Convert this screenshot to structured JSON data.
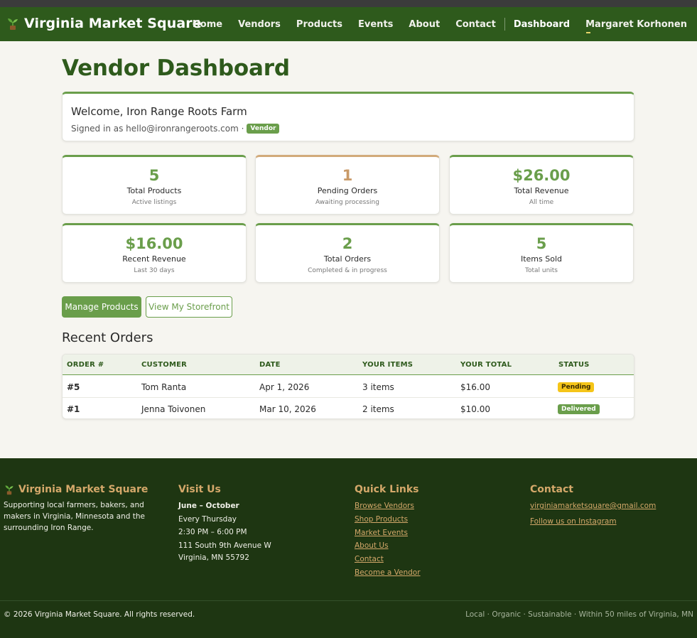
{
  "nav": {
    "brand": "Virginia Market Square",
    "links": [
      "Home",
      "Vendors",
      "Products",
      "Events",
      "About",
      "Contact"
    ],
    "dashboard": "Dashboard",
    "user": "Margaret Korhonen"
  },
  "page": {
    "title": "Vendor Dashboard",
    "welcome_title": "Welcome, Iron Range Roots Farm",
    "signed_in_text": "Signed in as hello@ironrangeroots.com ·",
    "role_badge": "Vendor"
  },
  "stats": [
    {
      "value": "5",
      "label": "Total Products",
      "sub": "Active listings"
    },
    {
      "value": "1",
      "label": "Pending Orders",
      "sub": "Awaiting processing"
    },
    {
      "value": "$26.00",
      "label": "Total Revenue",
      "sub": "All time"
    },
    {
      "value": "$16.00",
      "label": "Recent Revenue",
      "sub": "Last 30 days"
    },
    {
      "value": "2",
      "label": "Total Orders",
      "sub": "Completed & in progress"
    },
    {
      "value": "5",
      "label": "Items Sold",
      "sub": "Total units"
    }
  ],
  "actions": {
    "manage": "Manage Products",
    "storefront": "View My Storefront"
  },
  "orders": {
    "heading": "Recent Orders",
    "columns": [
      "ORDER #",
      "CUSTOMER",
      "DATE",
      "YOUR ITEMS",
      "YOUR TOTAL",
      "STATUS"
    ],
    "rows": [
      {
        "order": "#5",
        "customer": "Tom Ranta",
        "date": "Apr 1, 2026",
        "items": "3 items",
        "total": "$16.00",
        "status": "Pending"
      },
      {
        "order": "#1",
        "customer": "Jenna Toivonen",
        "date": "Mar 10, 2026",
        "items": "2 items",
        "total": "$10.00",
        "status": "Delivered"
      }
    ]
  },
  "footer": {
    "brand": "Virginia Market Square",
    "about": "Supporting local farmers, bakers, and makers in Virginia, Minnesota and the surrounding Iron Range.",
    "visit_heading": "Visit Us",
    "season": "June – October",
    "day": "Every Thursday",
    "hours": "2:30 PM – 6:00 PM",
    "address1": "111 South 9th Avenue W",
    "address2": "Virginia, MN 55792",
    "links_heading": "Quick Links",
    "links": [
      "Browse Vendors",
      "Shop Products",
      "Market Events",
      "About Us",
      "Contact",
      "Become a Vendor"
    ],
    "contact_heading": "Contact",
    "email": "virginiamarketsquare@gmail.com",
    "instagram": "Follow us on Instagram",
    "copyright": "© 2026 Virginia Market Square. All rights reserved.",
    "tagline": "Local · Organic · Sustainable · Within 50 miles of Virginia, MN"
  },
  "colors": {
    "nav_bg": "#2e5a1c",
    "accent_green": "#6a9e4b",
    "pending_tan": "#c99a68",
    "footer_bg": "#1e3612",
    "footer_gold": "#d4a86a",
    "status_pending": "#f5c518"
  },
  "icons": {
    "brand": "sprout-icon"
  }
}
